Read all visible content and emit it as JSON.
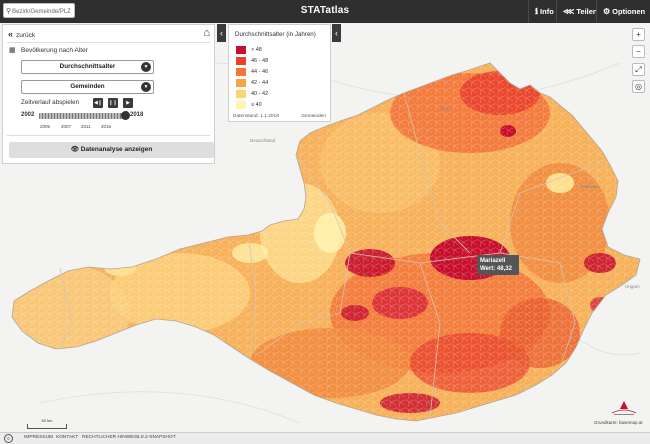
{
  "topbar": {
    "search_placeholder": "Bezirk/Gemeinde/PLZ",
    "app_title": "STATatlas",
    "buttons": [
      {
        "label": "Info",
        "icon": "info-icon"
      },
      {
        "label": "Teilen",
        "icon": "share-icon"
      },
      {
        "label": "Optionen",
        "icon": "gear-icon"
      }
    ]
  },
  "panel": {
    "back_label": "zurück",
    "title": "Bevölkerung nach Alter",
    "dropdown_indicator": "Durchschnittsalter",
    "dropdown_level": "Gemeinden",
    "play_label": "Zeitverlauf abspielen",
    "year_start": "2002",
    "year_end": "2018",
    "ticks": [
      "2005",
      "2007",
      "2011",
      "2015"
    ],
    "slider_position": 1.0,
    "analyse_button": "Datenanalyse anzeigen"
  },
  "legend": {
    "title": "Durchschnittsalter (in Jahren)",
    "classes": [
      {
        "label": "> 48",
        "color": "#c8102e"
      },
      {
        "label": "46 - 48",
        "color": "#e8402c"
      },
      {
        "label": "44 - 46",
        "color": "#f2763a"
      },
      {
        "label": "42 - 44",
        "color": "#f8a543"
      },
      {
        "label": "40 - 42",
        "color": "#fcd470"
      },
      {
        "label": "≤ 40",
        "color": "#fff5b0"
      }
    ],
    "date": "Datenstand: 1.1.2018",
    "unit": "Gemeinden"
  },
  "map_controls": [
    {
      "label": "+",
      "icon": "zoom-in-icon"
    },
    {
      "label": "−",
      "icon": "zoom-out-icon"
    },
    {
      "label": "⤢",
      "icon": "fullscreen-icon"
    },
    {
      "label": "◎",
      "icon": "locate-icon"
    }
  ],
  "tooltip": {
    "name": "Mariazell",
    "value": "Wert: 48,32"
  },
  "scale_label": "50 km",
  "attribution": "Grundkarte: basemap.at",
  "footer": {
    "links": [
      "IMPRESSUM",
      "KONTAKT",
      "RECHTLICHER HINWEIS",
      "1.8.2-SNAPSHOT"
    ]
  },
  "colors": {
    "topbar": "#2f2f2f",
    "border": "#d0d0d0"
  }
}
